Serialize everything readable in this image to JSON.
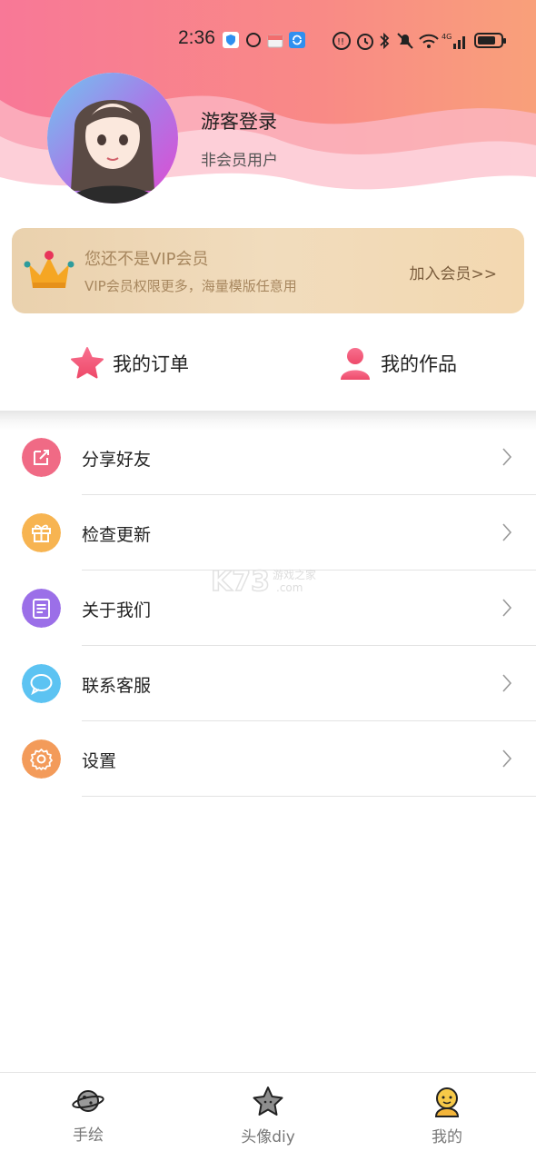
{
  "status_bar": {
    "time": "2:36",
    "icons": [
      "shield-app-icon",
      "circle-icon",
      "gift-app-icon",
      "sync-app-icon",
      "data-saver-icon",
      "alarm-icon",
      "bluetooth-icon",
      "mute-icon",
      "wifi-icon",
      "signal-4g-icon",
      "battery-icon"
    ]
  },
  "profile": {
    "name": "游客登录",
    "status": "非会员用户"
  },
  "vip": {
    "title": "您还不是VIP会员",
    "subtitle": "VIP会员权限更多，海量模版任意用",
    "join": "加入会员>>"
  },
  "quick_actions": [
    {
      "label": "我的订单",
      "icon": "star-icon"
    },
    {
      "label": "我的作品",
      "icon": "person-icon"
    }
  ],
  "menu": [
    {
      "label": "分享好友",
      "icon": "share-icon",
      "color": "#f06a85"
    },
    {
      "label": "检查更新",
      "icon": "gift-icon",
      "color": "#f7b451"
    },
    {
      "label": "关于我们",
      "icon": "document-icon",
      "color": "#9b6fe8"
    },
    {
      "label": "联系客服",
      "icon": "chat-icon",
      "color": "#5cc3f2"
    },
    {
      "label": "设置",
      "icon": "gear-icon",
      "color": "#f39b5a"
    }
  ],
  "watermark": {
    "brand": "K73",
    "text": "游戏之家",
    "domain": ".com"
  },
  "bottom_nav": [
    {
      "label": "手绘",
      "icon": "planet-icon"
    },
    {
      "label": "头像diy",
      "icon": "star-outline-icon"
    },
    {
      "label": "我的",
      "icon": "smiley-avatar-icon",
      "active": true
    }
  ],
  "colors": {
    "header_pink": "#f77a95",
    "header_orange": "#f9a36e",
    "vip_text": "#a7875f",
    "accent": "#f0506e"
  }
}
